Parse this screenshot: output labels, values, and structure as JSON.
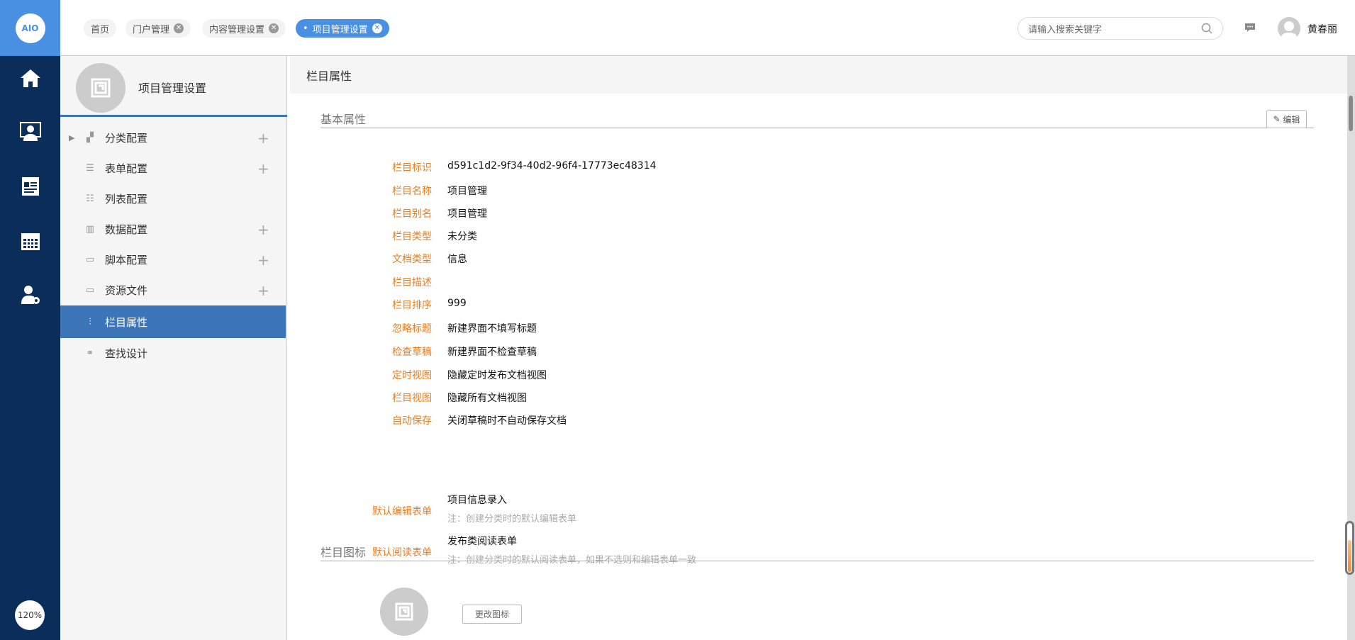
{
  "nav": {
    "logo": "AIO",
    "icons": [
      "home-icon",
      "monitor-user-icon",
      "news-icon",
      "calendar-icon",
      "user-settings-icon"
    ],
    "zoom": "120%"
  },
  "tabs": [
    {
      "label": "首页",
      "closable": false
    },
    {
      "label": "门户管理",
      "closable": true
    },
    {
      "label": "内容管理设置",
      "closable": true
    },
    {
      "label": "项目管理设置",
      "closable": true,
      "active": true
    }
  ],
  "search": {
    "placeholder": "请输入搜索关键字"
  },
  "user": {
    "name": "黄春丽"
  },
  "sidebar": {
    "title": "项目管理设置",
    "items": [
      {
        "label": "分类配置",
        "icon": "▞",
        "plus": "+",
        "expand": "▶"
      },
      {
        "label": "表单配置",
        "icon": "☰",
        "plus": "+"
      },
      {
        "label": "列表配置",
        "icon": "☷"
      },
      {
        "label": "数据配置",
        "icon": "▥",
        "plus": "+"
      },
      {
        "label": "脚本配置",
        "icon": "▭",
        "plus": "+"
      },
      {
        "label": "资源文件",
        "icon": "▭",
        "plus": "+"
      },
      {
        "label": "栏目属性",
        "icon": "⫶",
        "active": true
      },
      {
        "label": "查找设计",
        "icon": "⚭"
      }
    ]
  },
  "main": {
    "header": "栏目属性",
    "section1": "基本属性",
    "edit": "编辑",
    "rows": [
      {
        "label": "栏目标识",
        "value": "d591c1d2-9f34-40d2-96f4-17773ec48314"
      },
      {
        "label": "栏目名称",
        "value": "项目管理"
      },
      {
        "label": "栏目别名",
        "value": "项目管理"
      },
      {
        "label": "栏目类型",
        "value": "未分类"
      },
      {
        "label": "文档类型",
        "value": "信息"
      },
      {
        "label": "栏目描述",
        "value": ""
      },
      {
        "label": "栏目排序",
        "value": "999"
      },
      {
        "label": "忽略标题",
        "value": "新建界面不填写标题"
      },
      {
        "label": "检查草稿",
        "value": "新建界面不检查草稿"
      },
      {
        "label": "定时视图",
        "value": "隐藏定时发布文档视图"
      },
      {
        "label": "栏目视图",
        "value": "隐藏所有文档视图"
      },
      {
        "label": "自动保存",
        "value": "关闭草稿时不自动保存文档"
      }
    ],
    "edit_form": {
      "label": "默认编辑表单",
      "value": "项目信息录入",
      "note": "注：创建分类时的默认编辑表单"
    },
    "read_form": {
      "label": "默认阅读表单",
      "value": "发布类阅读表单",
      "note": "注：创建分类时的默认阅读表单，如果不选则和编辑表单一致"
    },
    "section2": "栏目图标",
    "change_icon": "更改图标"
  },
  "colors": {
    "nav": "#0b2d5a",
    "accent": "#4a90e2",
    "active": "#3c76b8",
    "label": "#e67e22"
  }
}
